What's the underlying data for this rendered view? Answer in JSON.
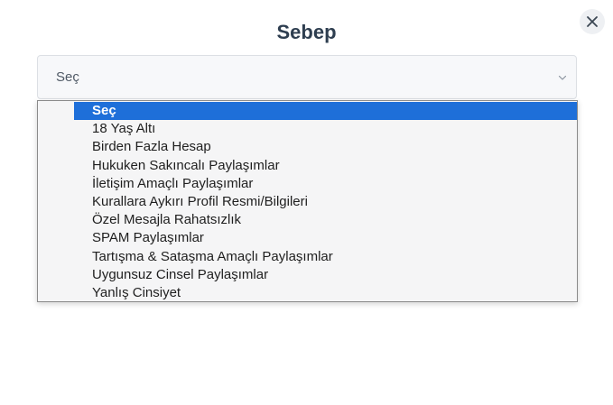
{
  "modal": {
    "title": "Sebep",
    "close_icon": "close-icon"
  },
  "select": {
    "value": "Seç",
    "chevron_icon": "chevron-down-icon"
  },
  "options": [
    {
      "label": "Seç",
      "selected": true
    },
    {
      "label": "18 Yaş Altı",
      "selected": false
    },
    {
      "label": "Birden Fazla Hesap",
      "selected": false
    },
    {
      "label": "Hukuken Sakıncalı Paylaşımlar",
      "selected": false
    },
    {
      "label": "İletişim Amaçlı Paylaşımlar",
      "selected": false
    },
    {
      "label": "Kurallara Aykırı Profil Resmi/Bilgileri",
      "selected": false
    },
    {
      "label": "Özel Mesajla Rahatsızlık",
      "selected": false
    },
    {
      "label": "SPAM Paylaşımlar",
      "selected": false
    },
    {
      "label": "Tartışma & Sataşma Amaçlı Paylaşımlar",
      "selected": false
    },
    {
      "label": "Uygunsuz Cinsel Paylaşımlar",
      "selected": false
    },
    {
      "label": "Yanlış Cinsiyet",
      "selected": false
    }
  ],
  "colors": {
    "title": "#2e3e50",
    "highlight": "#1e6fd9",
    "close_bg": "#eef0f3"
  }
}
